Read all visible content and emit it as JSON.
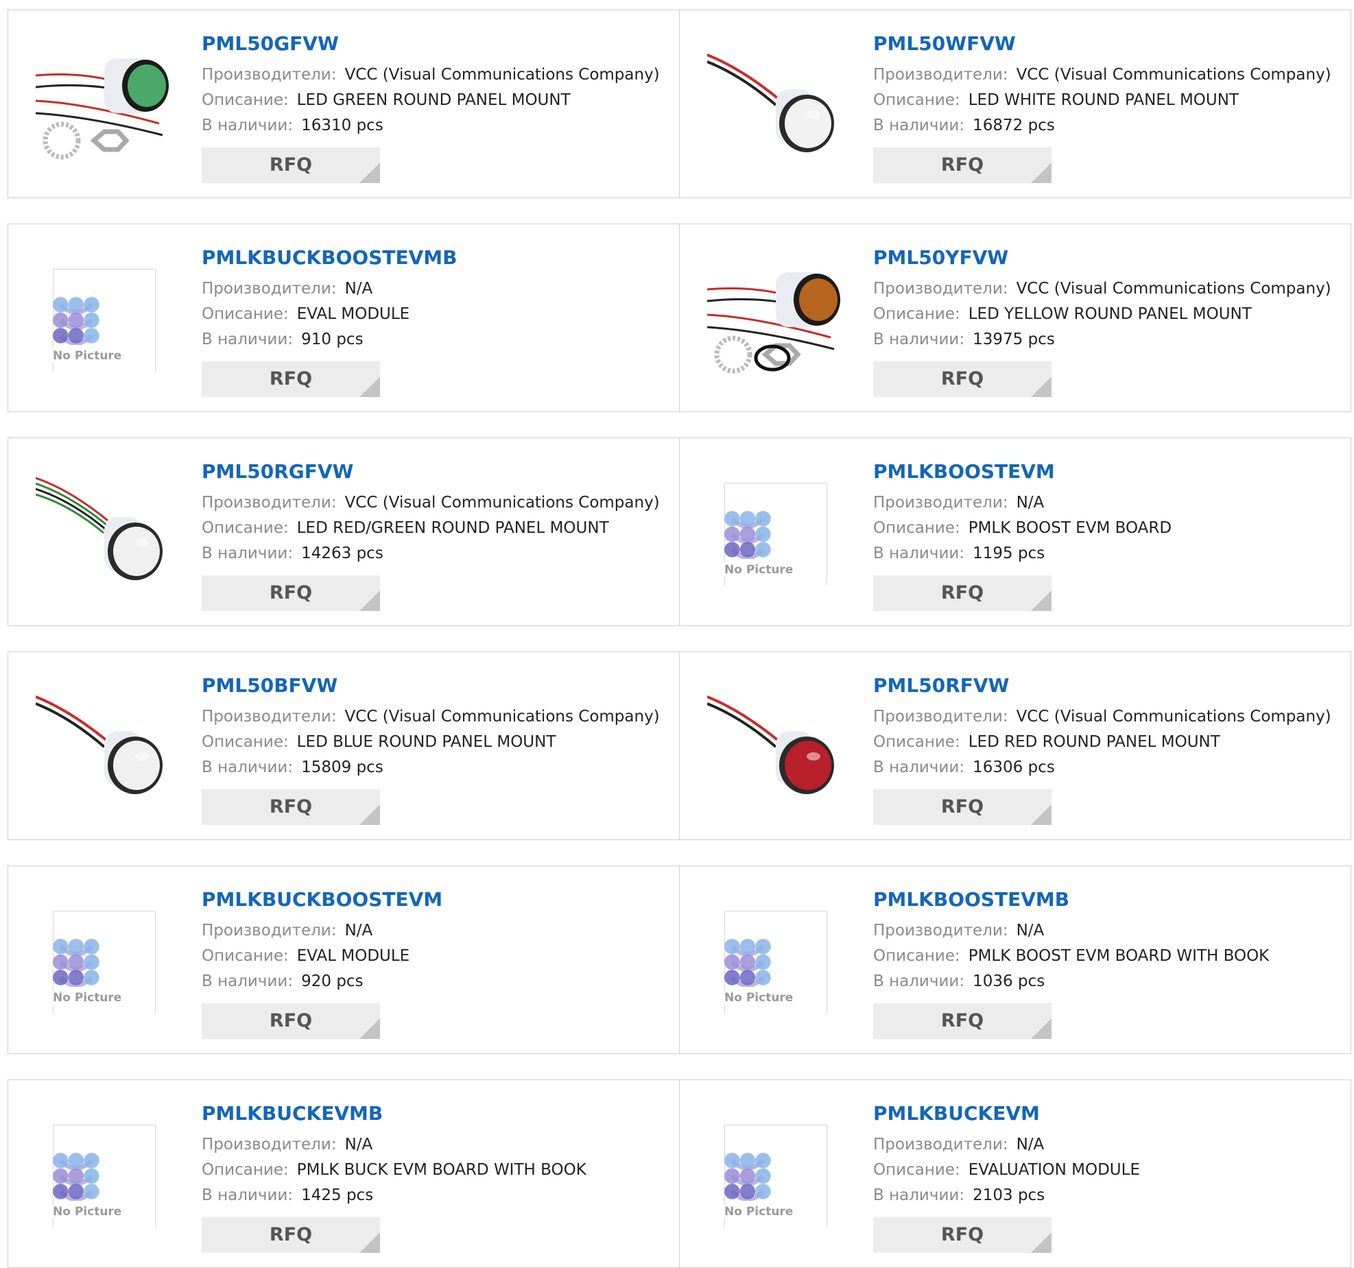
{
  "labels": {
    "manufacturer": "Производители:",
    "description": "Описание:",
    "stock": "В наличии:",
    "rfq": "RFQ",
    "no_picture": "No Picture"
  },
  "colors": {
    "link": "#1466b8",
    "label_gray": "#8a8a8a",
    "rfq_bg": "#ececec",
    "border": "#cfcfcf"
  },
  "products": [
    {
      "part": "PML50GFVW",
      "manufacturer": "VCC (Visual Communications Company)",
      "description": "LED GREEN ROUND PANEL MOUNT",
      "stock": "16310 pcs",
      "image": "led-green-with-hardware"
    },
    {
      "part": "PML50WFVW",
      "manufacturer": "VCC (Visual Communications Company)",
      "description": "LED WHITE ROUND PANEL MOUNT",
      "stock": "16872 pcs",
      "image": "led-white"
    },
    {
      "part": "PMLKBUCKBOOSTEVMB",
      "manufacturer": "N/A",
      "description": "EVAL MODULE",
      "stock": "910 pcs",
      "image": "no-picture"
    },
    {
      "part": "PML50YFVW",
      "manufacturer": "VCC (Visual Communications Company)",
      "description": "LED YELLOW ROUND PANEL MOUNT",
      "stock": "13975 pcs",
      "image": "led-yellow-with-hardware"
    },
    {
      "part": "PML50RGFVW",
      "manufacturer": "VCC (Visual Communications Company)",
      "description": "LED RED/GREEN ROUND PANEL MOUNT",
      "stock": "14263 pcs",
      "image": "led-red-green"
    },
    {
      "part": "PMLKBOOSTEVM",
      "manufacturer": "N/A",
      "description": "PMLK BOOST EVM BOARD",
      "stock": "1195 pcs",
      "image": "no-picture"
    },
    {
      "part": "PML50BFVW",
      "manufacturer": "VCC (Visual Communications Company)",
      "description": "LED BLUE ROUND PANEL MOUNT",
      "stock": "15809 pcs",
      "image": "led-blue"
    },
    {
      "part": "PML50RFVW",
      "manufacturer": "VCC (Visual Communications Company)",
      "description": "LED RED ROUND PANEL MOUNT",
      "stock": "16306 pcs",
      "image": "led-red"
    },
    {
      "part": "PMLKBUCKBOOSTEVM",
      "manufacturer": "N/A",
      "description": "EVAL MODULE",
      "stock": "920 pcs",
      "image": "no-picture"
    },
    {
      "part": "PMLKBOOSTEVMB",
      "manufacturer": "N/A",
      "description": "PMLK BOOST EVM BOARD WITH BOOK",
      "stock": "1036 pcs",
      "image": "no-picture"
    },
    {
      "part": "PMLKBUCKEVMB",
      "manufacturer": "N/A",
      "description": "PMLK BUCK EVM BOARD WITH BOOK",
      "stock": "1425 pcs",
      "image": "no-picture"
    },
    {
      "part": "PMLKBUCKEVM",
      "manufacturer": "N/A",
      "description": "EVALUATION MODULE",
      "stock": "2103 pcs",
      "image": "no-picture"
    }
  ]
}
